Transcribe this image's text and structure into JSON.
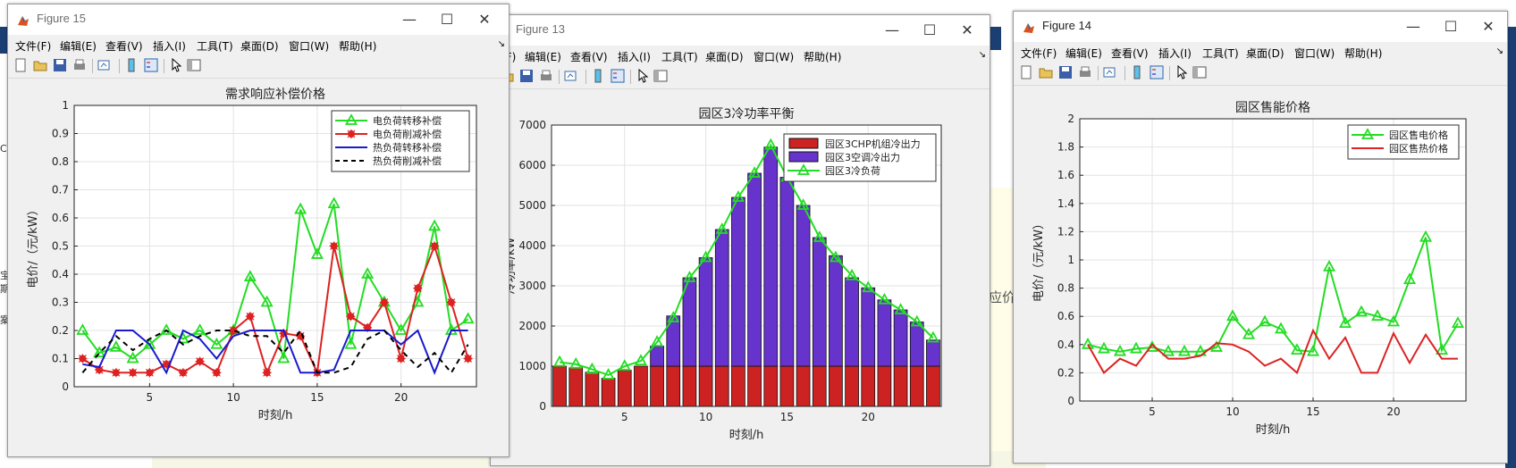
{
  "colors": {
    "green": "#22dd22",
    "red": "#dd2222",
    "blue": "#1a1acc",
    "black": "#000000",
    "bar_red": "#cc2222",
    "bar_purple": "#6633cc"
  },
  "left_fragment": {
    "lines": [
      "C",
      "宝",
      "期",
      "案"
    ]
  },
  "middle_fragment": {
    "text": "应价"
  },
  "menu_items": [
    "文件(F)",
    "编辑(E)",
    "查看(V)",
    "插入(I)",
    "工具(T)",
    "桌面(D)",
    "窗口(W)",
    "帮助(H)"
  ],
  "toolbar_icons": [
    "new-file-icon",
    "open-folder-icon",
    "save-icon",
    "print-icon",
    "link-plot-icon",
    "colorbar-icon",
    "legend-icon",
    "pointer-icon",
    "property-editor-icon"
  ],
  "fig15": {
    "window_title": "Figure 15",
    "chart_data": {
      "type": "line",
      "title": "需求响应补偿价格",
      "xlabel": "时刻/h",
      "ylabel": "电价/（元/kW）",
      "xlim": [
        0.5,
        24.5
      ],
      "ylim": [
        0,
        1
      ],
      "xticks": [
        5,
        10,
        15,
        20
      ],
      "yticks": [
        0,
        0.1,
        0.2,
        0.3,
        0.4,
        0.5,
        0.6,
        0.7,
        0.8,
        0.9,
        1
      ],
      "grid": true,
      "legend_position": "top-right",
      "x": [
        1,
        2,
        3,
        4,
        5,
        6,
        7,
        8,
        9,
        10,
        11,
        12,
        13,
        14,
        15,
        16,
        17,
        18,
        19,
        20,
        21,
        22,
        23,
        24
      ],
      "series": [
        {
          "name": "电负荷转移补偿",
          "color": "#22dd22",
          "marker": "triangle",
          "values": [
            0.2,
            0.12,
            0.14,
            0.1,
            0.15,
            0.2,
            0.17,
            0.2,
            0.15,
            0.2,
            0.39,
            0.3,
            0.1,
            0.63,
            0.47,
            0.65,
            0.15,
            0.4,
            0.3,
            0.2,
            0.3,
            0.57,
            0.2,
            0.24
          ]
        },
        {
          "name": "电负荷削减补偿",
          "color": "#dd2222",
          "marker": "star",
          "values": [
            0.1,
            0.06,
            0.05,
            0.05,
            0.05,
            0.08,
            0.05,
            0.09,
            0.05,
            0.2,
            0.25,
            0.05,
            0.19,
            0.18,
            0.05,
            0.5,
            0.25,
            0.21,
            0.3,
            0.1,
            0.35,
            0.5,
            0.3,
            0.1
          ]
        },
        {
          "name": "热负荷转移补偿",
          "color": "#1a1acc",
          "marker": "none",
          "values": [
            0.08,
            0.07,
            0.2,
            0.2,
            0.15,
            0.05,
            0.2,
            0.17,
            0.1,
            0.18,
            0.2,
            0.2,
            0.2,
            0.05,
            0.05,
            0.06,
            0.2,
            0.2,
            0.2,
            0.15,
            0.2,
            0.05,
            0.2,
            0.2
          ]
        },
        {
          "name": "热负荷削减补偿",
          "color": "#000000",
          "marker": "none",
          "dashed": true,
          "values": [
            0.05,
            0.12,
            0.18,
            0.13,
            0.17,
            0.2,
            0.15,
            0.18,
            0.2,
            0.2,
            0.18,
            0.18,
            0.12,
            0.2,
            0.05,
            0.05,
            0.07,
            0.17,
            0.2,
            0.13,
            0.07,
            0.12,
            0.05,
            0.15
          ]
        }
      ]
    }
  },
  "fig13": {
    "window_title": "Figure 13",
    "chart_data": {
      "type": "bar",
      "title": "园区3冷功率平衡",
      "xlabel": "时刻/h",
      "ylabel": "冷功率/kW",
      "xlim": [
        0.5,
        24.5
      ],
      "ylim": [
        0,
        7000
      ],
      "xticks": [
        5,
        10,
        15,
        20
      ],
      "yticks": [
        0,
        1000,
        2000,
        3000,
        4000,
        5000,
        6000,
        7000
      ],
      "grid": true,
      "stacked": true,
      "legend_position": "top-right",
      "x": [
        1,
        2,
        3,
        4,
        5,
        6,
        7,
        8,
        9,
        10,
        11,
        12,
        13,
        14,
        15,
        16,
        17,
        18,
        19,
        20,
        21,
        22,
        23,
        24
      ],
      "series": [
        {
          "name": "园区3CHP机组冷出力",
          "color": "#cc2222",
          "values": [
            1000,
            960,
            850,
            700,
            900,
            1000,
            1000,
            1000,
            1000,
            1000,
            1000,
            1000,
            1000,
            1000,
            1000,
            1000,
            1000,
            1000,
            1000,
            1000,
            1000,
            1000,
            1000,
            1000
          ]
        },
        {
          "name": "园区3空调冷出力",
          "color": "#6633cc",
          "values": [
            0,
            0,
            0,
            0,
            0,
            0,
            500,
            1250,
            2200,
            2700,
            3400,
            4200,
            4800,
            5450,
            4700,
            4000,
            3200,
            2750,
            2200,
            1950,
            1650,
            1400,
            1100,
            650
          ]
        },
        {
          "name": "园区3冷负荷",
          "color": "#22dd22",
          "type": "line",
          "values": [
            1100,
            1050,
            920,
            780,
            1000,
            1130,
            1600,
            2200,
            3200,
            3700,
            4400,
            5200,
            5800,
            6500,
            5700,
            5000,
            4200,
            3700,
            3250,
            2950,
            2650,
            2400,
            2100,
            1700
          ]
        }
      ]
    }
  },
  "fig14": {
    "window_title": "Figure 14",
    "chart_data": {
      "type": "line",
      "title": "园区售能价格",
      "xlabel": "时刻/h",
      "ylabel": "电价/（元/kW）",
      "xlim": [
        0.5,
        24.5
      ],
      "ylim": [
        0,
        2
      ],
      "xticks": [
        5,
        10,
        15,
        20
      ],
      "yticks": [
        0,
        0.2,
        0.4,
        0.6,
        0.8,
        1,
        1.2,
        1.4,
        1.6,
        1.8,
        2
      ],
      "grid": true,
      "legend_position": "top-right",
      "x": [
        1,
        2,
        3,
        4,
        5,
        6,
        7,
        8,
        9,
        10,
        11,
        12,
        13,
        14,
        15,
        16,
        17,
        18,
        19,
        20,
        21,
        22,
        23,
        24
      ],
      "series": [
        {
          "name": "园区售电价格",
          "color": "#22dd22",
          "marker": "triangle",
          "values": [
            0.4,
            0.37,
            0.35,
            0.37,
            0.38,
            0.35,
            0.35,
            0.35,
            0.38,
            0.6,
            0.47,
            0.56,
            0.51,
            0.36,
            0.35,
            0.95,
            0.55,
            0.63,
            0.6,
            0.56,
            0.86,
            1.16,
            0.36,
            0.55
          ]
        },
        {
          "name": "园区售热价格",
          "color": "#dd2222",
          "marker": "none",
          "values": [
            0.4,
            0.2,
            0.3,
            0.25,
            0.4,
            0.3,
            0.3,
            0.32,
            0.41,
            0.4,
            0.35,
            0.25,
            0.3,
            0.2,
            0.5,
            0.3,
            0.45,
            0.2,
            0.2,
            0.48,
            0.27,
            0.47,
            0.3,
            0.3
          ]
        }
      ]
    }
  }
}
